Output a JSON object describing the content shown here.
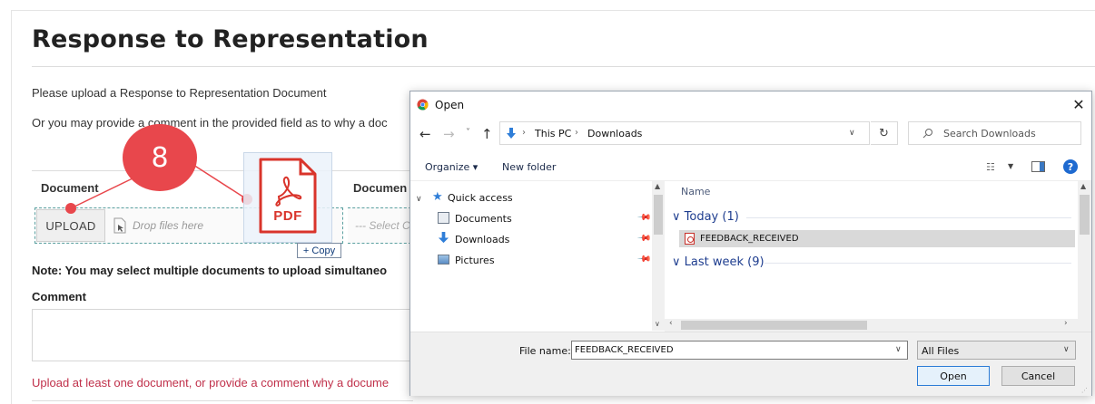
{
  "page": {
    "title": "Response to Representation",
    "instruction_1": "Please upload a Response to Representation Document",
    "instruction_2": "Or you may provide a comment in the provided field as to why a doc",
    "table": {
      "col1_header": "Document",
      "col2_header": "Documen",
      "upload_label": "UPLOAD",
      "drop_placeholder": "Drop files here",
      "select_placeholder": "--- Select C"
    },
    "note": "Note: You may select multiple documents to upload simultaneo",
    "comment_label": "Comment",
    "error_text": "Upload at least one document, or provide a comment why a docume"
  },
  "overlay": {
    "step_number": "8",
    "drag_file_label": "PDF",
    "drag_copy_label": "+ Copy",
    "colors": {
      "badge": "#e8474c",
      "pdf": "#d9342b"
    }
  },
  "dialog": {
    "title": "Open",
    "close_label": "✕",
    "address": {
      "seg1": "This PC",
      "seg2": "Downloads"
    },
    "search_placeholder": "Search Downloads",
    "toolbar": {
      "organize": "Organize ▾",
      "new_folder": "New folder"
    },
    "nav_items": [
      {
        "label": "Quick access"
      },
      {
        "label": "Documents"
      },
      {
        "label": "Downloads"
      },
      {
        "label": "Pictures"
      }
    ],
    "list": {
      "column_name": "Name",
      "groups": [
        {
          "label": "∨ Today (1)"
        },
        {
          "label": "∨ Last week (9)"
        }
      ],
      "files": [
        {
          "name": "FEEDBACK_RECEIVED",
          "icon": "pdf-file-icon"
        }
      ]
    },
    "file_name_label": "File name:",
    "file_name_value": "FEEDBACK_RECEIVED",
    "file_type": "All Files",
    "open_label": "Open",
    "cancel_label": "Cancel"
  }
}
